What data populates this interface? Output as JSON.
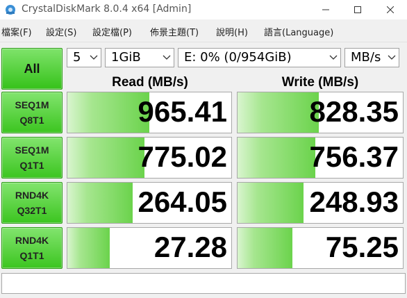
{
  "window": {
    "title": "CrystalDiskMark 8.0.4 x64 [Admin]"
  },
  "menu": [
    "檔案(F)",
    "設定(S)",
    "設定檔(P)",
    "佈景主題(T)",
    "說明(H)",
    "語言(Language)"
  ],
  "controls": {
    "all_label": "All",
    "count": "5",
    "size": "1GiB",
    "drive": "E: 0% (0/954GiB)",
    "unit": "MB/s"
  },
  "headers": {
    "read": "Read (MB/s)",
    "write": "Write (MB/s)"
  },
  "tests": [
    {
      "line1": "SEQ1M",
      "line2": "Q8T1",
      "read": "965.41",
      "write": "828.35",
      "read_fill": 0.5,
      "write_fill": 0.49
    },
    {
      "line1": "SEQ1M",
      "line2": "Q1T1",
      "read": "775.02",
      "write": "756.37",
      "read_fill": 0.47,
      "write_fill": 0.47
    },
    {
      "line1": "RND4K",
      "line2": "Q32T1",
      "read": "264.05",
      "write": "248.93",
      "read_fill": 0.4,
      "write_fill": 0.4
    },
    {
      "line1": "RND4K",
      "line2": "Q1T1",
      "read": "27.28",
      "write": "75.25",
      "read_fill": 0.26,
      "write_fill": 0.33
    }
  ],
  "status_text": "",
  "colors": {
    "accent_green": "#36c21a",
    "bar_green": "#6bd34c"
  }
}
